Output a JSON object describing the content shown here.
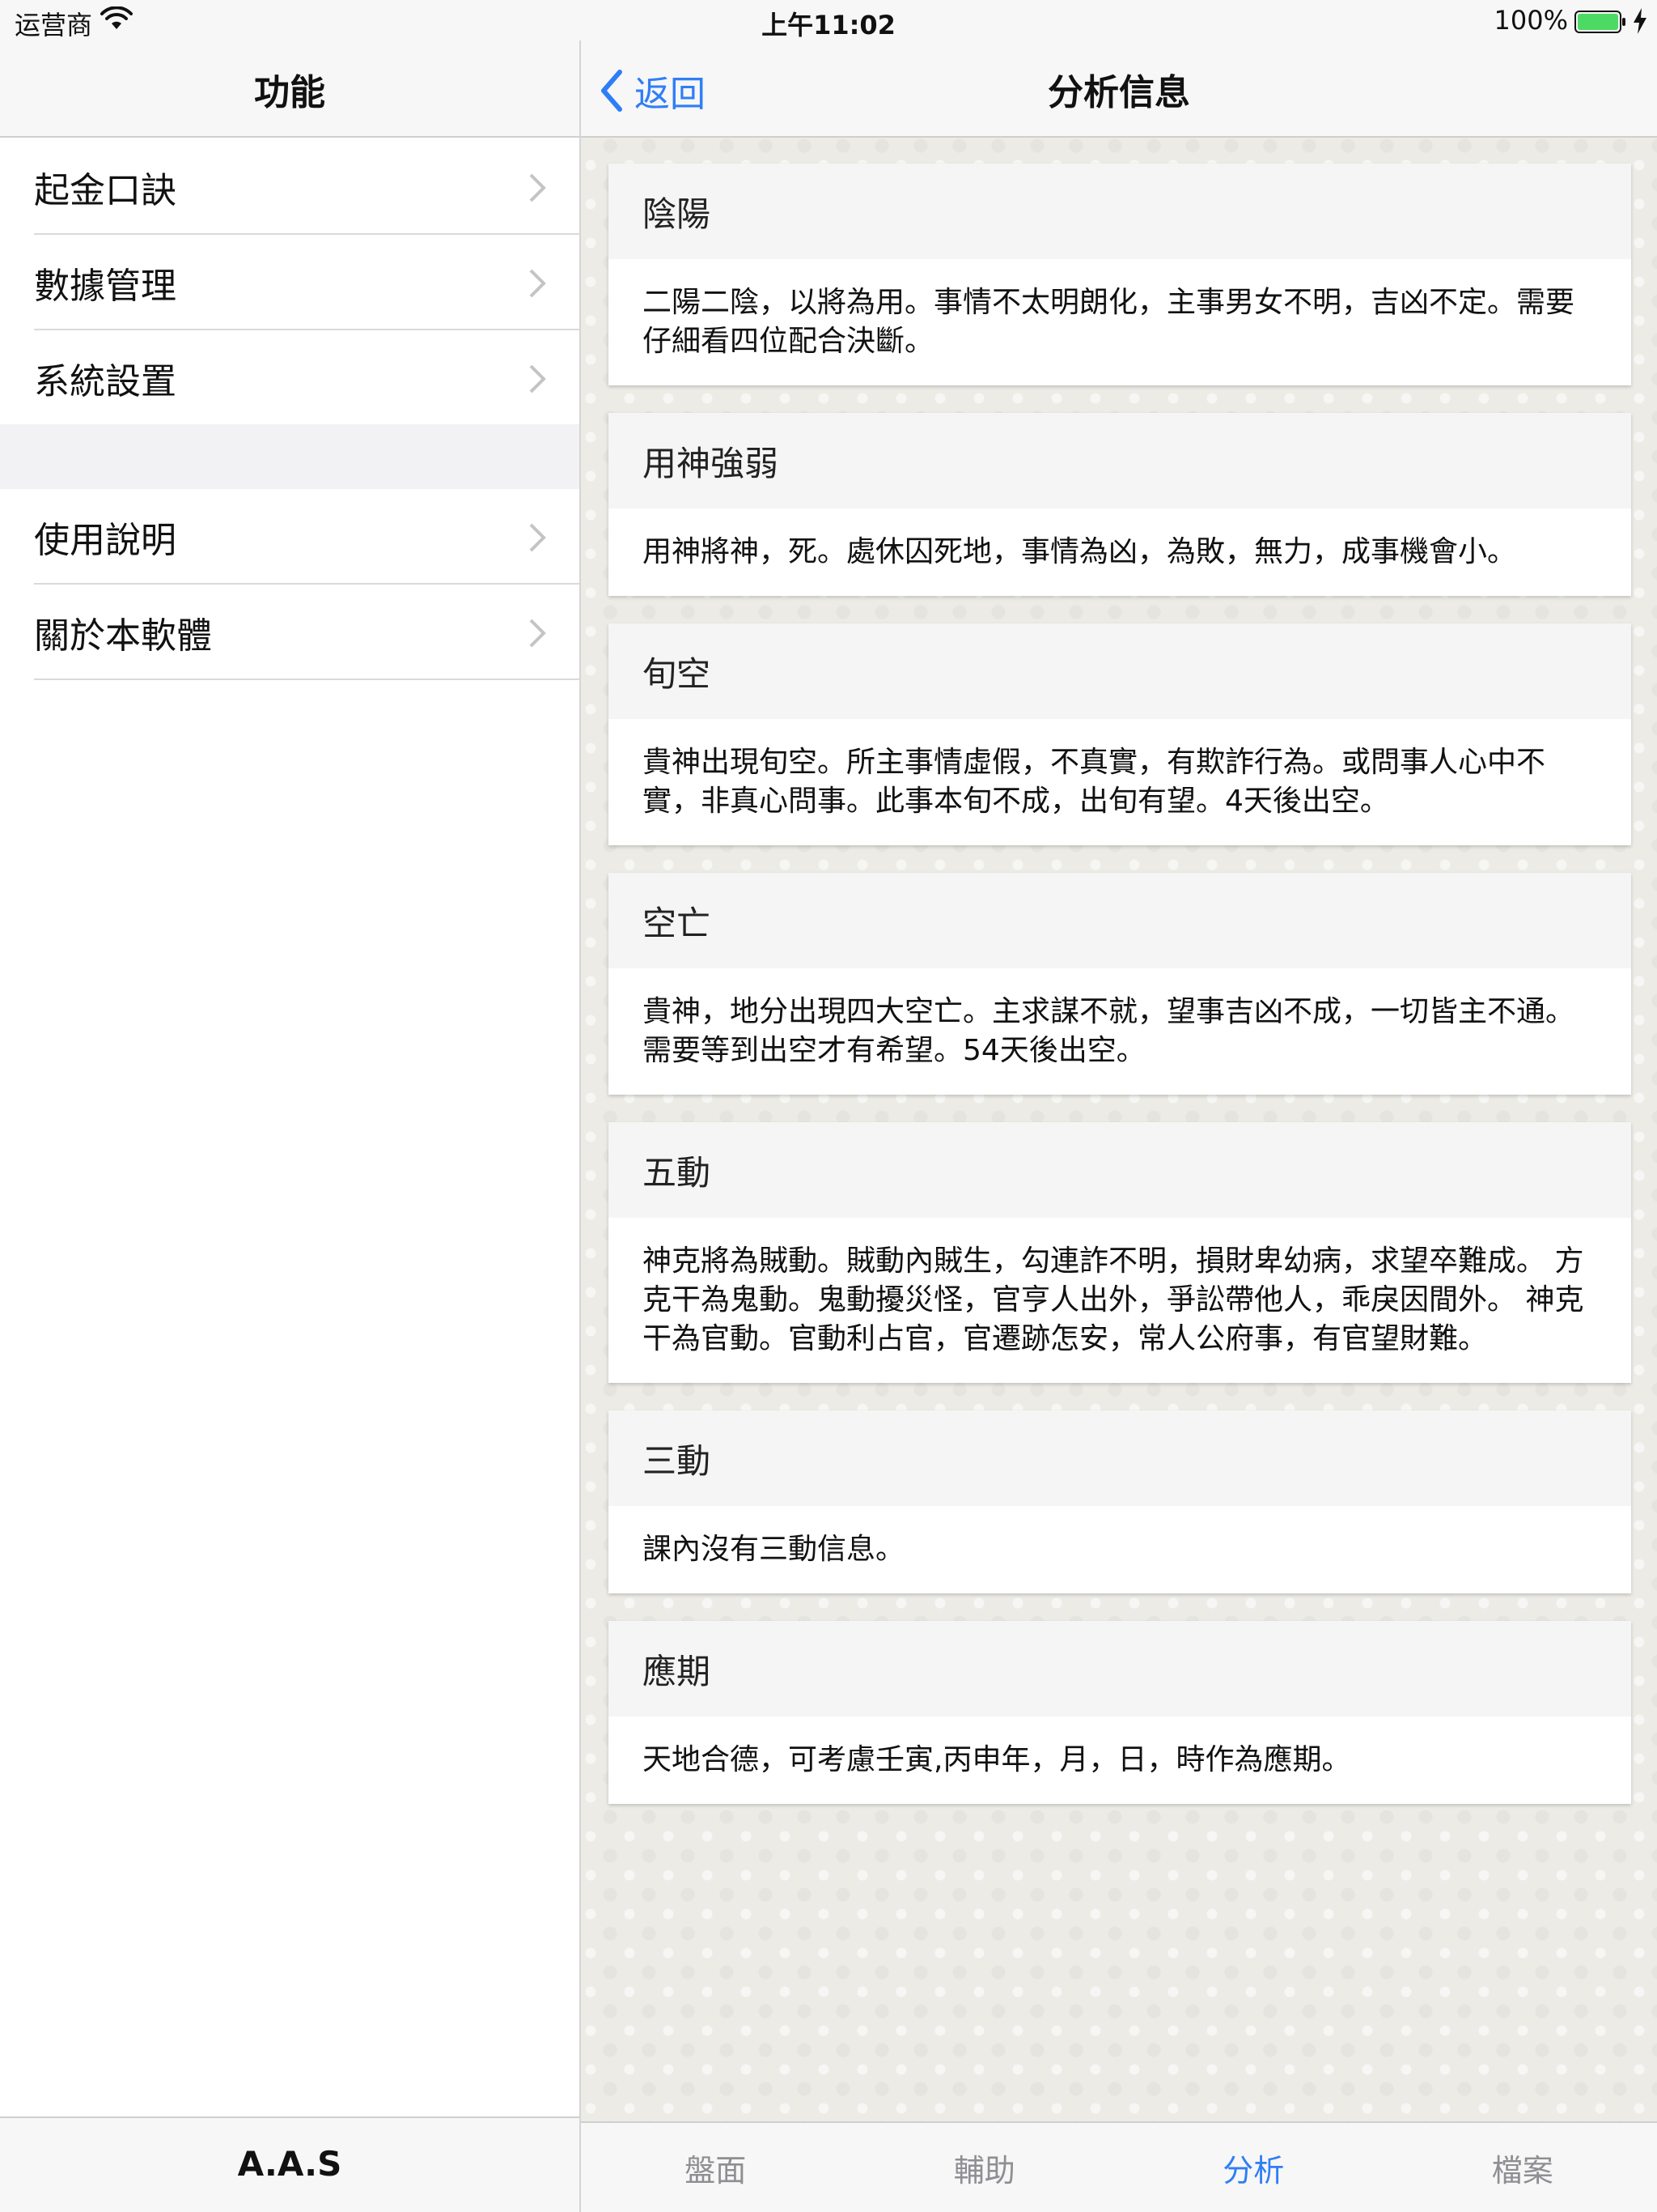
{
  "status": {
    "carrier": "运营商",
    "time": "上午11:02",
    "battery": "100%"
  },
  "colors": {
    "accent": "#2f7ef6",
    "battery": "#4cd964"
  },
  "master": {
    "title": "功能",
    "group1": [
      {
        "label": "起金口訣"
      },
      {
        "label": "數據管理"
      },
      {
        "label": "系統設置"
      }
    ],
    "group2": [
      {
        "label": "使用說明"
      },
      {
        "label": "關於本軟體"
      }
    ],
    "footer": "A.A.S"
  },
  "detail": {
    "back_label": "返回",
    "title": "分析信息",
    "cards": [
      {
        "heading": "陰陽",
        "body": "二陽二陰，以將為用。事情不太明朗化，主事男女不明，吉凶不定。需要仔細看四位配合決斷。"
      },
      {
        "heading": "用神強弱",
        "body": "用神將神，死。處休囚死地，事情為凶，為敗，無力，成事機會小。"
      },
      {
        "heading": "旬空",
        "body": "貴神出現旬空。所主事情虛假，不真實，有欺詐行為。或問事人心中不實，非真心問事。此事本旬不成，出旬有望。4天後出空。"
      },
      {
        "heading": "空亡",
        "body": "貴神，地分出現四大空亡。主求謀不就，望事吉凶不成，一切皆主不通。需要等到出空才有希望。54天後出空。"
      },
      {
        "heading": "五動",
        "body": "神克將為賊動。賊動內賊生，勾連詐不明，損財卑幼病，求望卒難成。 方克干為鬼動。鬼動擾災怪，官亨人出外，爭訟帶他人，乖戾因間外。 神克干為官動。官動利占官，官遷跡怎安，常人公府事，有官望財難。"
      },
      {
        "heading": "三動",
        "body": "課內沒有三動信息。"
      },
      {
        "heading": "應期",
        "body": "天地合德，可考慮壬寅,丙申年，月，日，時作為應期。"
      }
    ],
    "tabs": [
      {
        "label": "盤面",
        "active": false
      },
      {
        "label": "輔助",
        "active": false
      },
      {
        "label": "分析",
        "active": true
      },
      {
        "label": "檔案",
        "active": false
      }
    ]
  }
}
